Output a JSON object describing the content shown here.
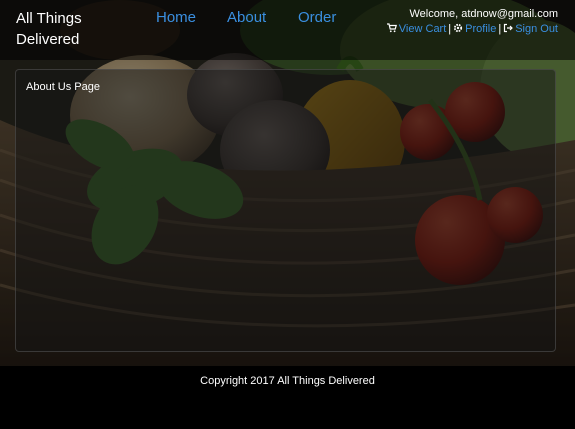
{
  "brand": {
    "line1": "All Things",
    "line2": "Delivered"
  },
  "nav": {
    "items": [
      {
        "label": "Home"
      },
      {
        "label": "About"
      },
      {
        "label": "Order"
      }
    ]
  },
  "user": {
    "welcome": "Welcome, atdnow@gmail.com",
    "view_cart": "View Cart",
    "profile": "Profile",
    "sign_out": "Sign Out",
    "separator": "|"
  },
  "page": {
    "title": "About Us Page"
  },
  "footer": {
    "copyright": "Copyright 2017 All Things Delivered"
  },
  "colors": {
    "link": "#3a8fe0",
    "header_bg": "#000000",
    "footer_bg": "#000000"
  },
  "icons": {
    "cart": "cart-icon",
    "profile": "gear-icon",
    "sign_out": "sign-out-icon"
  }
}
